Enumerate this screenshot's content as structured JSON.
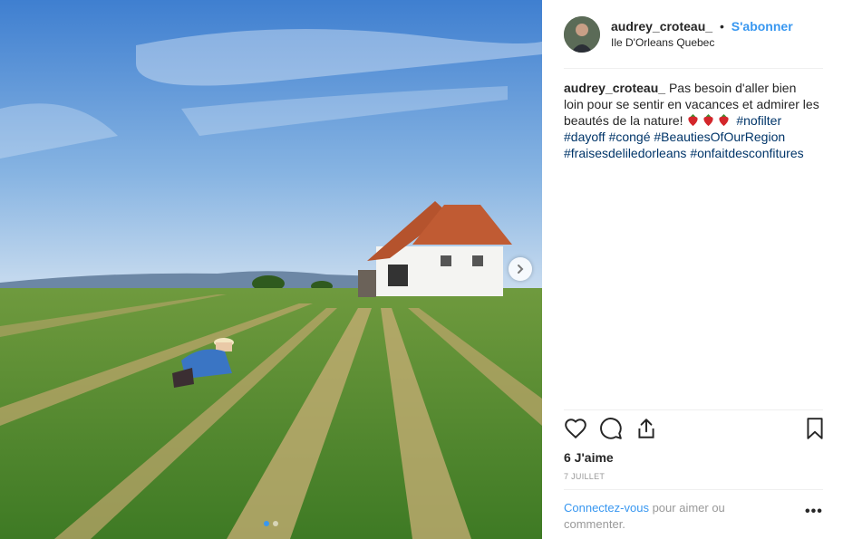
{
  "header": {
    "username": "audrey_croteau_",
    "separator": "•",
    "follow_label": "S'abonner",
    "location": "Ile D'Orleans Quebec"
  },
  "caption": {
    "username": "audrey_croteau_",
    "text": "Pas besoin d'aller bien loin pour se sentir en vacances et admirer les beautés de la nature!",
    "emojis": [
      "strawberry-icon",
      "strawberry-icon",
      "strawberry-icon"
    ],
    "hashtags": [
      "#nofilter",
      "#dayoff",
      "#congé",
      "#BeautiesOfOurRegion",
      "#fraisesdeliledorleans",
      "#onfaitdesconfitures"
    ]
  },
  "actions": {
    "icons": [
      "heart-icon",
      "comment-icon",
      "share-icon",
      "bookmark-icon"
    ]
  },
  "likes_label": "6 J'aime",
  "date_label": "7 JUILLET",
  "login_prompt": {
    "link_label": "Connectez-vous",
    "rest": "pour aimer ou commenter."
  },
  "more_label": "•••",
  "carousel": {
    "slide_count": 2,
    "current_slide": 1
  },
  "colors": {
    "accent": "#3897f0",
    "hashtag": "#003569",
    "muted": "#999999",
    "text": "#262626"
  }
}
